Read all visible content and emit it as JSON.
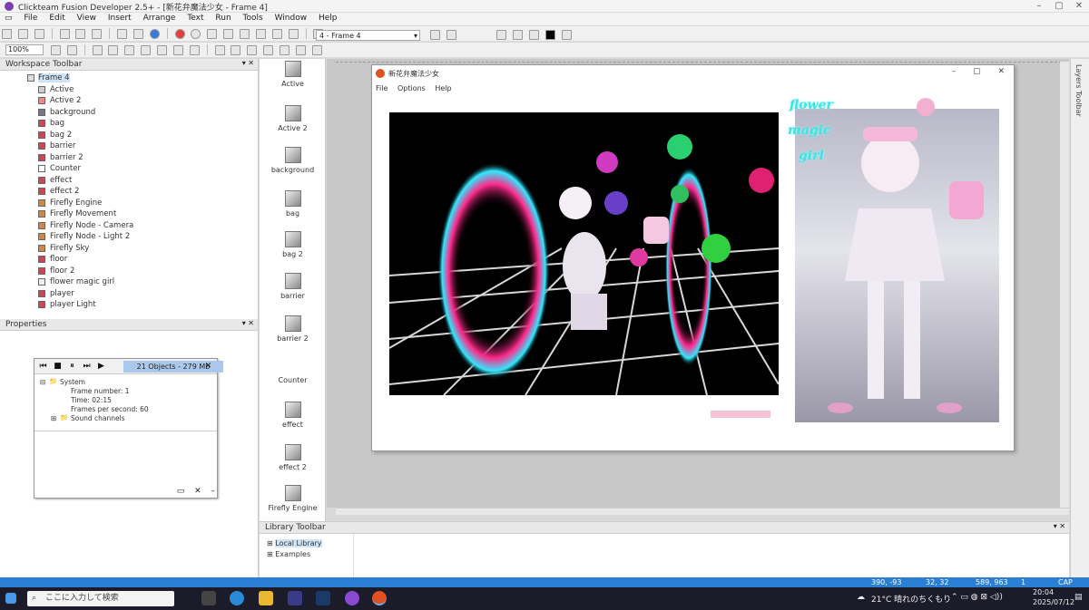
{
  "window": {
    "title": "Clickteam Fusion Developer 2.5+ - [新花弁魔法少女 - Frame 4]"
  },
  "menu": [
    "File",
    "Edit",
    "View",
    "Insert",
    "Arrange",
    "Text",
    "Run",
    "Tools",
    "Window",
    "Help"
  ],
  "toolbar": {
    "zoom": "100%",
    "frame_selector": "4 - Frame 4"
  },
  "workspace": {
    "title": "Workspace Toolbar",
    "root": "Frame 4",
    "items": [
      "Active",
      "Active 2",
      "background",
      "bag",
      "bag 2",
      "barrier",
      "barrier 2",
      "Counter",
      "effect",
      "effect 2",
      "Firefly Engine",
      "Firefly Movement",
      "Firefly Node - Camera",
      "Firefly Node - Light 2",
      "Firefly Sky",
      "floor",
      "floor 2",
      "flower magic girl",
      "player",
      "player Light"
    ]
  },
  "properties": {
    "title": "Properties"
  },
  "debugger": {
    "objects": "21 Objects - 279 Mb",
    "system": "System",
    "frame_number": "Frame number: 1",
    "time": "Time: 02:15",
    "fps": "Frames per second: 60",
    "sound_channels": "Sound channels"
  },
  "object_list": [
    "Active",
    "Active 2",
    "background",
    "bag",
    "bag 2",
    "barrier",
    "barrier 2",
    "Counter",
    "effect",
    "effect 2",
    "Firefly Engine"
  ],
  "app_window": {
    "title": "新花弁魔法少女",
    "menu": [
      "File",
      "Options",
      "Help"
    ],
    "flower_text": [
      "flower",
      "magic",
      "girl"
    ]
  },
  "right_dock": {
    "label": "Layers Toolbar"
  },
  "library": {
    "title": "Library Toolbar",
    "items": [
      "Local Library",
      "Examples"
    ]
  },
  "status": {
    "coords": "390, -93",
    "size": "32, 32",
    "pos": "589, 963",
    "count": "1",
    "caps": "CAP  NUM"
  },
  "taskbar": {
    "search_placeholder": "ここに入力して検索",
    "weather": "21°C  晴れのちくもり",
    "time": "20:04",
    "date": "2025/07/12"
  },
  "colors": {
    "status_bar": "#2a7fd4",
    "taskbar": "#1b1b2a",
    "flower_text": "#45e0e0"
  }
}
